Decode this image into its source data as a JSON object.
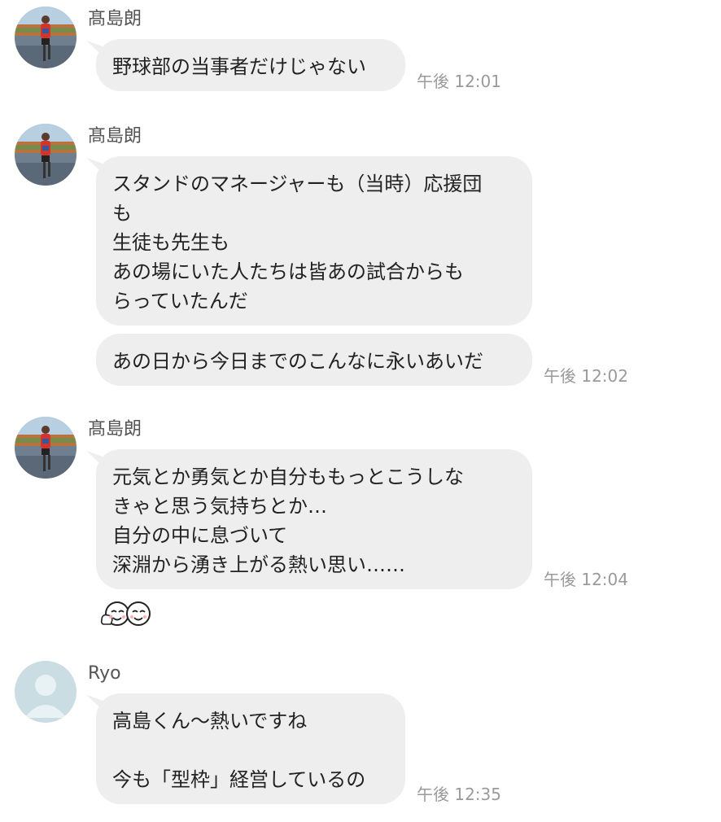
{
  "messages": [
    {
      "sender": "髙島朗",
      "bubbles": [
        {
          "text": "野球部の当事者だけじゃない",
          "time": "午後 12:01"
        }
      ]
    },
    {
      "sender": "髙島朗",
      "bubbles": [
        {
          "text": "スタンドのマネージャーも（当時）応援団\nも\n生徒も先生も\nあの場にいた人たちは皆あの試合からも\nらっていたんだ"
        },
        {
          "text": "あの日から今日までのこんなに永いあいだ",
          "time": "午後 12:02"
        }
      ]
    },
    {
      "sender": "髙島朗",
      "bubbles": [
        {
          "text": "元気とか勇気とか自分ももっとこうしな\nきゃと思う気持ちとか…\n自分の中に息づいて\n深淵から湧き上がる熱い思い……",
          "time": "午後 12:04"
        }
      ],
      "sticker": "thumbs-up-faces-sticker"
    },
    {
      "sender": "Ryo",
      "bubbles": [
        {
          "text": "高島くん〜熱いですね\n\n今も「型枠」経営しているの",
          "time": "午後 12:35"
        }
      ]
    }
  ],
  "colors": {
    "bubble": "#eeeeee",
    "time": "#9a9a9a",
    "sender": "#555555",
    "default_avatar": "#c9dde3"
  }
}
